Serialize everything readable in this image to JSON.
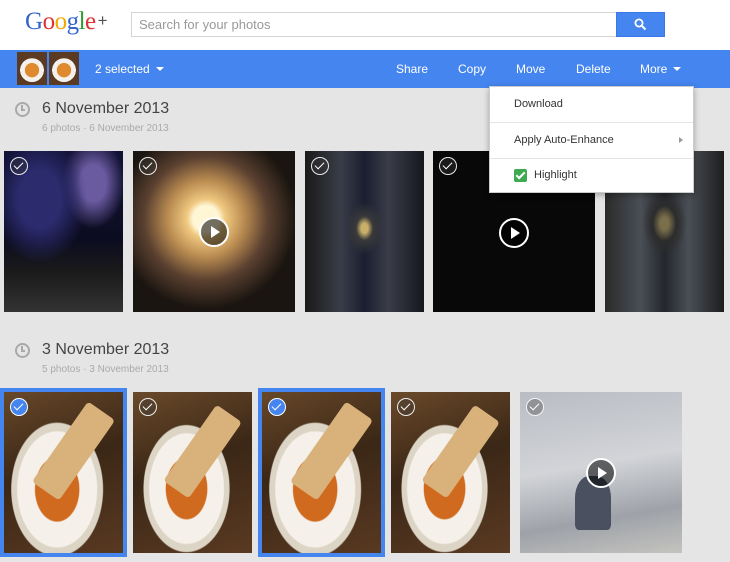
{
  "header": {
    "logo_letters": [
      "G",
      "o",
      "o",
      "g",
      "l",
      "e"
    ],
    "logo_colors": [
      "#3366cc",
      "#dd3333",
      "#eeaa00",
      "#3366cc",
      "#339933",
      "#dd3333"
    ],
    "logo_plus": "+",
    "search_placeholder": "Search for your photos",
    "search_icon": "search-icon"
  },
  "selection_bar": {
    "count_label": "2 selected",
    "actions": {
      "share": "Share",
      "copy": "Copy",
      "move": "Move",
      "delete": "Delete",
      "more": "More"
    }
  },
  "menu": {
    "download": "Download",
    "auto_enhance": "Apply Auto-Enhance",
    "highlight": "Highlight",
    "highlight_checked": true
  },
  "sections": [
    {
      "title": "6 November 2013",
      "subtitle": "6 photos · 6 November 2013",
      "photos": [
        {
          "kind": "concert",
          "video": false,
          "selected": false
        },
        {
          "kind": "candle",
          "video": true,
          "selected": false
        },
        {
          "kind": "corridor",
          "video": false,
          "selected": false
        },
        {
          "kind": "black",
          "video": true,
          "selected": false
        },
        {
          "kind": "corridor",
          "video": false,
          "selected": false
        }
      ]
    },
    {
      "title": "3 November 2013",
      "subtitle": "5 photos · 3 November 2013",
      "photos": [
        {
          "kind": "soup",
          "video": false,
          "selected": true
        },
        {
          "kind": "soup",
          "video": false,
          "selected": false
        },
        {
          "kind": "soup",
          "video": false,
          "selected": true
        },
        {
          "kind": "soup",
          "video": false,
          "selected": false
        },
        {
          "kind": "wall",
          "video": true,
          "selected": false
        }
      ]
    }
  ],
  "colors": {
    "accent": "#4585ef",
    "highlight_check": "#3daa52"
  }
}
